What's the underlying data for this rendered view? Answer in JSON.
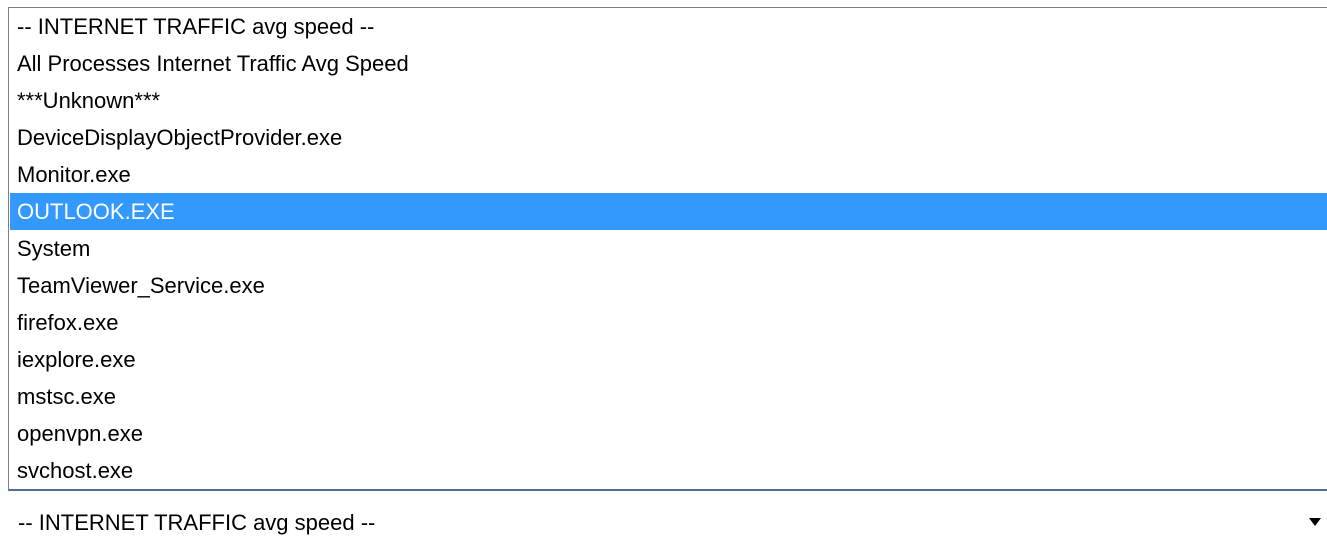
{
  "dropdown": {
    "selected_value": "-- INTERNET TRAFFIC avg speed --",
    "options": [
      {
        "label": "-- INTERNET TRAFFIC avg speed --"
      },
      {
        "label": "All Processes Internet Traffic Avg Speed"
      },
      {
        "label": "***Unknown***"
      },
      {
        "label": "DeviceDisplayObjectProvider.exe"
      },
      {
        "label": "Monitor.exe"
      },
      {
        "label": "OUTLOOK.EXE"
      },
      {
        "label": "System"
      },
      {
        "label": "TeamViewer_Service.exe"
      },
      {
        "label": "firefox.exe"
      },
      {
        "label": "iexplore.exe"
      },
      {
        "label": "mstsc.exe"
      },
      {
        "label": "openvpn.exe"
      },
      {
        "label": "svchost.exe"
      }
    ],
    "highlighted_option": "OUTLOOK.EXE",
    "icon": "chevron-down-icon"
  },
  "colors": {
    "highlight_background": "#3399ff",
    "highlight_text": "#ffffff",
    "border": "#7f7f7f",
    "bottom_border": "#4e6f9c"
  }
}
